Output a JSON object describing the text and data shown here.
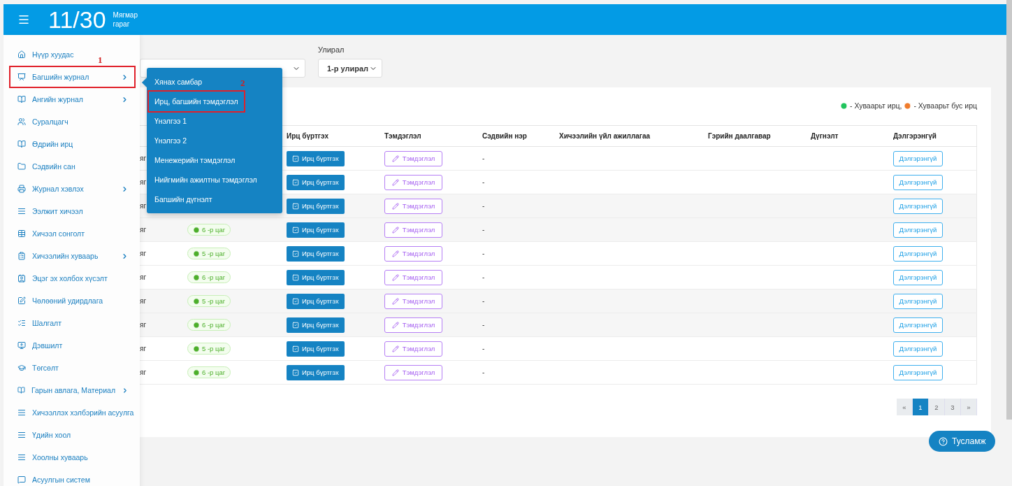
{
  "header": {
    "date": "11/30",
    "weekday": "Мягмар гараг"
  },
  "sidebar": {
    "items": [
      {
        "label": "Нүүр хуудас",
        "has_submenu": false,
        "highlighted": false
      },
      {
        "label": "Багшийн журнал",
        "has_submenu": true,
        "highlighted": true,
        "annotation": "1"
      },
      {
        "label": "Ангийн журнал",
        "has_submenu": true,
        "highlighted": false
      },
      {
        "label": "Суралцагч",
        "has_submenu": false,
        "highlighted": false
      },
      {
        "label": "Өдрийн ирц",
        "has_submenu": false,
        "highlighted": false
      },
      {
        "label": "Сэдвийн сан",
        "has_submenu": false,
        "highlighted": false
      },
      {
        "label": "Журнал хэвлэх",
        "has_submenu": true,
        "highlighted": false
      },
      {
        "label": "Ээлжит хичээл",
        "has_submenu": false,
        "highlighted": false
      },
      {
        "label": "Хичээл сонголт",
        "has_submenu": false,
        "highlighted": false
      },
      {
        "label": "Хичээлийн хуваарь",
        "has_submenu": true,
        "highlighted": false
      },
      {
        "label": "Эцэг эх холбох хүсэлт",
        "has_submenu": false,
        "highlighted": false
      },
      {
        "label": "Чөлөөний удирдлага",
        "has_submenu": false,
        "highlighted": false
      },
      {
        "label": "Шалгалт",
        "has_submenu": false,
        "highlighted": false
      },
      {
        "label": "Дэвшилт",
        "has_submenu": false,
        "highlighted": false
      },
      {
        "label": "Төгсөлт",
        "has_submenu": false,
        "highlighted": false
      },
      {
        "label": "Гарын авлага, Материал",
        "has_submenu": true,
        "highlighted": false
      },
      {
        "label": "Хичээллэх хэлбэрийн асуулга",
        "has_submenu": false,
        "highlighted": false
      },
      {
        "label": "Үдийн хоол",
        "has_submenu": false,
        "highlighted": false
      },
      {
        "label": "Хоолны хуваарь",
        "has_submenu": false,
        "highlighted": false
      },
      {
        "label": "Асуулгын систем",
        "has_submenu": false,
        "highlighted": false
      }
    ]
  },
  "submenu": {
    "items": [
      {
        "label": "Хянах самбар",
        "highlighted": false
      },
      {
        "label": "Ирц, багшийн тэмдэглэл",
        "highlighted": true,
        "annotation": "2"
      },
      {
        "label": "Үнэлгээ 1",
        "highlighted": false
      },
      {
        "label": "Үнэлгээ 2",
        "highlighted": false
      },
      {
        "label": "Менежерийн тэмдэглэл",
        "highlighted": false
      },
      {
        "label": "Нийгмийн ажилтны тэмдэглэл",
        "highlighted": false
      },
      {
        "label": "Багшийн дүгнэлт",
        "highlighted": false
      }
    ]
  },
  "filters": {
    "semester": {
      "label": "Улирал",
      "value": "1-р улирал"
    }
  },
  "legend": [
    {
      "label": "- Хуваарьт ирц,",
      "color": "#21c45d"
    },
    {
      "label": "- Хуваарьт бус ирц",
      "color": "#f07c2c"
    }
  ],
  "table": {
    "columns": [
      "Ирц бүртгэх",
      "Тэмдэглэл",
      "Сэдвийн нэр",
      "Хичээлийн үйл ажиллагаа",
      "Гэрийн даалгавар",
      "Дүгнэлт",
      "Дэлгэрэнгүй"
    ],
    "rows": [
      {
        "date_tail": "яг",
        "attendance": "Ирц бүртгэх",
        "note": "Тэмдэглэл",
        "topic": "-",
        "details": "Дэлгэрэнгүй"
      },
      {
        "date_tail": "яг",
        "attendance": "Ирц бүртгэх",
        "note": "Тэмдэглэл",
        "topic": "-",
        "details": "Дэлгэрэнгүй"
      },
      {
        "date_tail": "яг",
        "attendance": "Ирц бүртгэх",
        "note": "Тэмдэглэл",
        "topic": "-",
        "details": "Дэлгэрэнгүй"
      },
      {
        "date_tail": "яг",
        "period": "6 -р цаг",
        "attendance": "Ирц бүртгэх",
        "note": "Тэмдэглэл",
        "topic": "-",
        "details": "Дэлгэрэнгүй"
      },
      {
        "date_tail": "яг",
        "period": "5 -р цаг",
        "attendance": "Ирц бүртгэх",
        "note": "Тэмдэглэл",
        "topic": "-",
        "details": "Дэлгэрэнгүй"
      },
      {
        "date_tail": "яг",
        "period": "6 -р цаг",
        "attendance": "Ирц бүртгэх",
        "note": "Тэмдэглэл",
        "topic": "-",
        "details": "Дэлгэрэнгүй"
      },
      {
        "date_tail": "яг",
        "period": "5 -р цаг",
        "attendance": "Ирц бүртгэх",
        "note": "Тэмдэглэл",
        "topic": "-",
        "details": "Дэлгэрэнгүй"
      },
      {
        "date_tail": "яг",
        "period": "6 -р цаг",
        "attendance": "Ирц бүртгэх",
        "note": "Тэмдэглэл",
        "topic": "-",
        "details": "Дэлгэрэнгүй"
      },
      {
        "date_tail": "яг",
        "period": "5 -р цаг",
        "attendance": "Ирц бүртгэх",
        "note": "Тэмдэглэл",
        "topic": "-",
        "details": "Дэлгэрэнгүй"
      },
      {
        "date_tail": "яг",
        "period": "6 -р цаг",
        "attendance": "Ирц бүртгэх",
        "note": "Тэмдэглэл",
        "topic": "-",
        "details": "Дэлгэрэнгүй"
      }
    ]
  },
  "pagination": [
    {
      "label": "«",
      "selected": false
    },
    {
      "label": "1",
      "selected": true
    },
    {
      "label": "2",
      "selected": false
    },
    {
      "label": "3",
      "selected": false
    },
    {
      "label": "»",
      "selected": false
    }
  ],
  "help_button": "Тусламж"
}
